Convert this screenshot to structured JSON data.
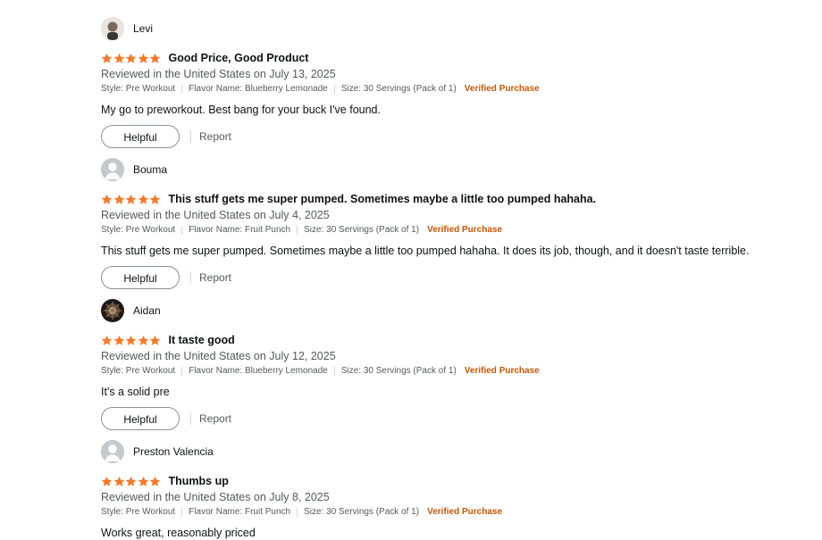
{
  "colors": {
    "star": "#f4792a",
    "verified": "#c45500",
    "muted_text": "#565959",
    "primary_text": "#0f1111"
  },
  "reviews": [
    {
      "name": "Levi",
      "avatar_icon": "user-photo-avatar",
      "rating": 5,
      "title": "Good Price, Good Product",
      "date": "Reviewed in the United States on July 13, 2025",
      "style": "Style: Pre Workout",
      "flavor": "Flavor Name: Blueberry Lemonade",
      "size": "Size: 30 Servings (Pack of 1)",
      "verified": "Verified Purchase",
      "body": "My go to preworkout.  Best bang for your buck I've found.",
      "helpful_label": "Helpful",
      "report_label": "Report"
    },
    {
      "name": "Bouma",
      "avatar_icon": "default-user-avatar",
      "rating": 5,
      "title": "This stuff gets me super pumped. Sometimes maybe a little too pumped hahaha.",
      "date": "Reviewed in the United States on July 4, 2025",
      "style": "Style: Pre Workout",
      "flavor": "Flavor Name: Fruit Punch",
      "size": "Size: 30 Servings (Pack of 1)",
      "verified": "Verified Purchase",
      "body": "This stuff gets me super pumped. Sometimes maybe a little too pumped hahaha. It does its job, though, and it doesn't taste terrible.",
      "helpful_label": "Helpful",
      "report_label": "Report"
    },
    {
      "name": "Aidan",
      "avatar_icon": "user-photo-avatar",
      "rating": 5,
      "title": "It taste good",
      "date": "Reviewed in the United States on July 12, 2025",
      "style": "Style: Pre Workout",
      "flavor": "Flavor Name: Blueberry Lemonade",
      "size": "Size: 30 Servings (Pack of 1)",
      "verified": "Verified Purchase",
      "body": "It's a solid pre",
      "helpful_label": "Helpful",
      "report_label": "Report"
    },
    {
      "name": "Preston Valencia",
      "avatar_icon": "default-user-avatar",
      "rating": 5,
      "title": "Thumbs up",
      "date": "Reviewed in the United States on July 8, 2025",
      "style": "Style: Pre Workout",
      "flavor": "Flavor Name: Fruit Punch",
      "size": "Size: 30 Servings (Pack of 1)",
      "verified": "Verified Purchase",
      "body": "Works great, reasonably priced",
      "helpful_label": "Helpful",
      "report_label": "Report"
    }
  ]
}
